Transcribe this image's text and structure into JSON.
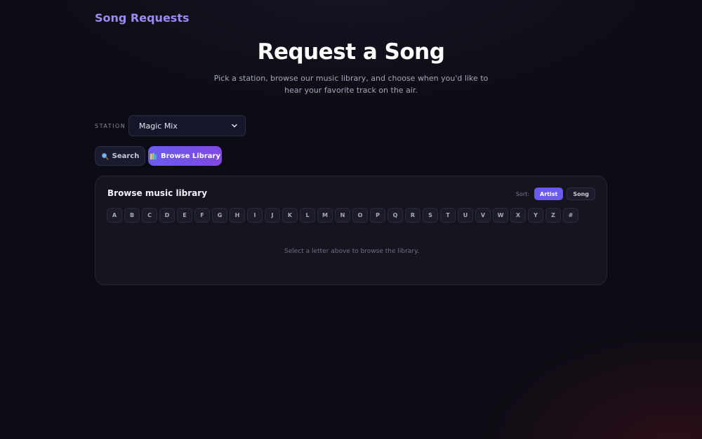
{
  "brand": "Song Requests",
  "hero": {
    "title": "Request a Song",
    "subtitle": "Pick a station, browse our music library, and choose when you'd like to hear your favorite track on the air."
  },
  "station": {
    "label": "STATION",
    "selected": "Magic Mix"
  },
  "tabs": {
    "search_label": "Search",
    "browse_label": "Browse Library",
    "active": "Browse Library"
  },
  "library": {
    "title": "Browse music library",
    "sort_label": "Sort:",
    "sort_options": [
      "Artist",
      "Song"
    ],
    "sort_active": "Artist",
    "letters": [
      "A",
      "B",
      "C",
      "D",
      "E",
      "F",
      "G",
      "H",
      "I",
      "J",
      "K",
      "L",
      "M",
      "N",
      "O",
      "P",
      "Q",
      "R",
      "S",
      "T",
      "U",
      "V",
      "W",
      "X",
      "Y",
      "Z",
      "#"
    ],
    "empty_message": "Select a letter above to browse the library."
  },
  "icons": {
    "search": "magnifier-icon",
    "browse": "library-icon",
    "select": "chevron-down-icon"
  },
  "colors": {
    "accent": "#6a5cf0",
    "brand": "#9a8cf0",
    "background": "#0c0c14"
  }
}
